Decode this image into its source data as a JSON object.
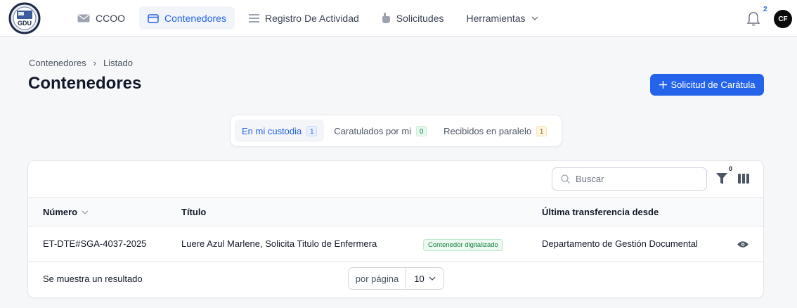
{
  "nav": {
    "logo_text": "GDU",
    "items": [
      {
        "label": "CCOO",
        "icon": "mail-icon"
      },
      {
        "label": "Contenedores",
        "icon": "folder-icon",
        "active": true
      },
      {
        "label": "Registro De Actividad",
        "icon": "list-icon"
      },
      {
        "label": "Solicitudes",
        "icon": "hand-icon"
      },
      {
        "label": "Herramientas",
        "icon": "chevron-down-icon"
      }
    ],
    "notifications": "2",
    "avatar": "CF"
  },
  "breadcrumb": [
    "Contenedores",
    "Listado"
  ],
  "page_title": "Contenedores",
  "primary_action": "Solicitud de Carátula",
  "tabs": [
    {
      "label": "En mi custodia",
      "count": "1",
      "color": "blue",
      "active": true
    },
    {
      "label": "Caratulados por mi",
      "count": "0",
      "color": "green"
    },
    {
      "label": "Recibidos en paralelo",
      "count": "1",
      "color": "yellow"
    }
  ],
  "table": {
    "search_placeholder": "Buscar",
    "filter_count": "0",
    "columns": [
      "Número",
      "Título",
      "Última transferencia desde"
    ],
    "rows": [
      {
        "numero": "ET-DTE#SGA-4037-2025",
        "titulo": "Luere Azul Marlene, Solicita Titulo de Enfermera",
        "estado": "Contenedor digitalizado",
        "transferencia": "Departamento de Gestión Documental"
      }
    ],
    "result_text": "Se muestra un resultado",
    "per_page_label": "por página",
    "per_page_value": "10"
  },
  "colors": {
    "accent": "#2563eb",
    "badge_green": "#15803d"
  }
}
